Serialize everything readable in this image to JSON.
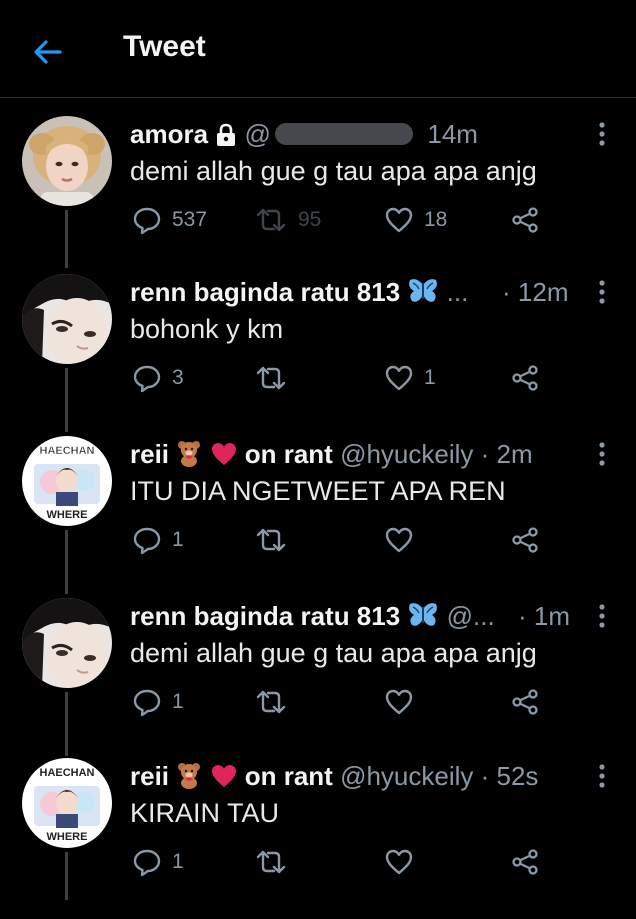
{
  "header": {
    "title": "Tweet"
  },
  "tweets": [
    {
      "name": "amora",
      "handle": "@",
      "time": "14m",
      "text": "demi allah gue g tau apa apa anjg",
      "replies": "537",
      "retweets": "95",
      "likes": "18"
    },
    {
      "name": "renn baginda ratu 813",
      "handle": "...",
      "time": "12m",
      "text": "bohonk y km",
      "replies": "3",
      "retweets": "",
      "likes": "1"
    },
    {
      "name": "reii",
      "name_suffix": "on rant",
      "handle": "@hyuckeily",
      "time": "2m",
      "text": "ITU DIA NGETWEET APA REN",
      "replies": "1",
      "retweets": "",
      "likes": "",
      "avatar_top": "HAECHAN",
      "avatar_bottom": "WHERE"
    },
    {
      "name": "renn baginda ratu 813",
      "handle": "@...",
      "time": "1m",
      "text": "demi allah gue g tau apa apa anjg",
      "replies": "1",
      "retweets": "",
      "likes": ""
    },
    {
      "name": "reii",
      "name_suffix": "on rant",
      "handle": "@hyuckeily",
      "time": "52s",
      "text": "KIRAIN TAU",
      "replies": "1",
      "retweets": "",
      "likes": "",
      "avatar_top": "HAECHAN",
      "avatar_bottom": "WHERE"
    }
  ],
  "colors": {
    "accent": "#1d9bf0",
    "heart": "#e0245e",
    "muted": "#8b98a5"
  }
}
